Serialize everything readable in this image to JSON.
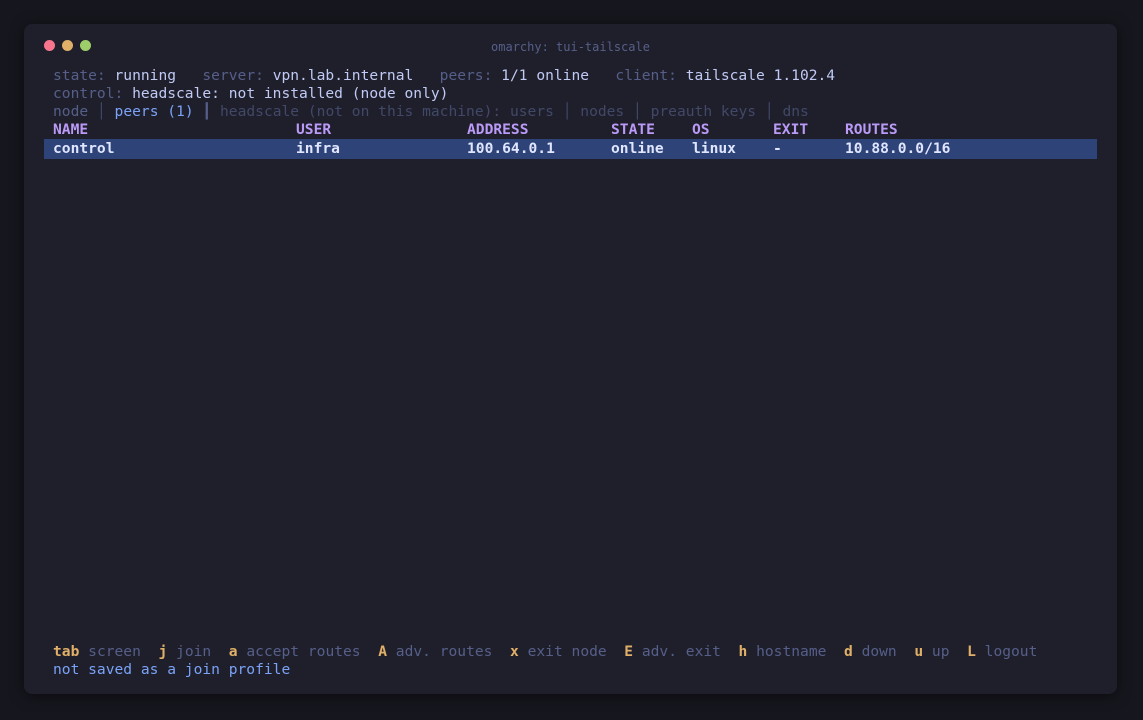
{
  "window": {
    "title": "omarchy: tui-tailscale",
    "dot_colors": {
      "close": "#f7768e",
      "minimize": "#e0af68",
      "maximize": "#9ece6a"
    }
  },
  "status": {
    "state_label": "state:",
    "state_value": "running",
    "server_label": "server:",
    "server_value": "vpn.lab.internal",
    "peers_label": "peers:",
    "peers_value": "1/1 online",
    "client_label": "client:",
    "client_value": "tailscale 1.102.4",
    "control_label": "control:",
    "control_value": "headscale: not installed (node only)"
  },
  "tabs": {
    "node": "node",
    "peers": "peers (1)",
    "headscale_users": "headscale (not on this machine): users",
    "nodes": "nodes",
    "preauth_keys": "preauth keys",
    "dns": "dns",
    "divider": "│",
    "strong_divider": "┃"
  },
  "table": {
    "columns": [
      "NAME",
      "USER",
      "ADDRESS",
      "STATE",
      "OS",
      "EXIT",
      "ROUTES"
    ],
    "rows": [
      {
        "name": "control",
        "user": "infra",
        "address": "100.64.0.1",
        "state": "online",
        "os": "linux",
        "exit": "-",
        "routes": "10.88.0.0/16"
      }
    ]
  },
  "keybinds": [
    {
      "key": "tab",
      "desc": "screen"
    },
    {
      "key": "j",
      "desc": "join"
    },
    {
      "key": "a",
      "desc": "accept routes"
    },
    {
      "key": "A",
      "desc": "adv. routes"
    },
    {
      "key": "x",
      "desc": "exit node"
    },
    {
      "key": "E",
      "desc": "adv. exit"
    },
    {
      "key": "h",
      "desc": "hostname"
    },
    {
      "key": "d",
      "desc": "down"
    },
    {
      "key": "u",
      "desc": "up"
    },
    {
      "key": "L",
      "desc": "logout"
    }
  ],
  "footer_note": "not saved as a join profile",
  "colors": {
    "background": "#16161e",
    "window": "#1f1f2b",
    "selection": "#2e4378",
    "header": "#bb9af7",
    "key": "#e0af68",
    "accent": "#7aa2f7"
  }
}
